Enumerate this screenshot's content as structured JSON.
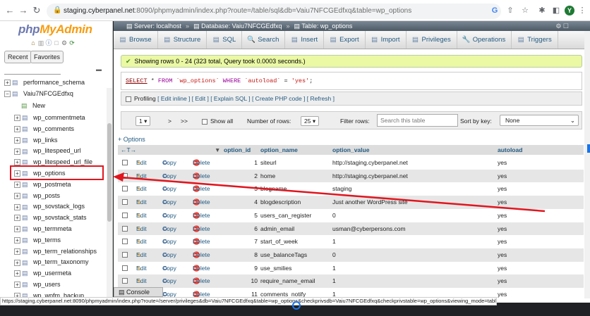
{
  "browser": {
    "url_host": "staging.cyberpanel.net",
    "url_rest": ":8090/phpmyadmin/index.php?route=/table/sql&db=Vaiu7NFCGEdfxq&table=wp_options",
    "avatar_letter": "Y",
    "icons": [
      "back-icon",
      "forward-icon",
      "reload-icon",
      "lock-icon",
      "google-icon",
      "share-icon",
      "star-icon",
      "extension-icon",
      "sidepanel-icon",
      "menu-icon"
    ]
  },
  "sidebar": {
    "logo_a": "php",
    "logo_b": "MyAdmin",
    "tab_recent": "Recent",
    "tab_favorites": "Favorites",
    "db_perf": "performance_schema",
    "db_current": "Vaiu7NFCGEdfxq",
    "new_label": "New",
    "tables": [
      "wp_commentmeta",
      "wp_comments",
      "wp_links",
      "wp_litespeed_url",
      "wp_litespeed_url_file",
      "wp_options",
      "wp_postmeta",
      "wp_posts",
      "wp_sovstack_logs",
      "wp_sovstack_stats",
      "wp_termmeta",
      "wp_terms",
      "wp_term_relationships",
      "wp_term_taxonomy",
      "wp_usermeta",
      "wp_users",
      "wp_wpfm_backup"
    ]
  },
  "breadcrumb": {
    "server": "Server: localhost",
    "database": "Database: Vaiu7NFCGEdfxq",
    "table": "Table: wp_options"
  },
  "menu": [
    "Browse",
    "Structure",
    "SQL",
    "Search",
    "Insert",
    "Export",
    "Import",
    "Privileges",
    "Operations",
    "Triggers"
  ],
  "message": "Showing rows 0 - 24 (323 total, Query took 0.0003 seconds.)",
  "sql": {
    "select": "SELECT",
    "star": " * ",
    "from": "FROM",
    "table": "`wp_options`",
    "where": "WHERE",
    "col": "`autoload`",
    "eq": " = ",
    "val": "'yes'",
    "end": ";"
  },
  "profiling": {
    "label": "Profiling",
    "links": "[ Edit inline ] [ Edit ] [ Explain SQL ] [ Create PHP code ] [ Refresh ]"
  },
  "nav": {
    "page": "1",
    "next": ">",
    "last": ">>",
    "show_all": "Show all",
    "rows_label": "Number of rows:",
    "rows_value": "25",
    "filter_label": "Filter rows:",
    "filter_placeholder": "Search this table",
    "sort_label": "Sort by key:",
    "sort_value": "None"
  },
  "options_link": "+ Options",
  "table": {
    "headers": {
      "id": "option_id",
      "name": "option_name",
      "value": "option_value",
      "autoload": "autoload"
    },
    "actions": {
      "edit": "Edit",
      "copy": "Copy",
      "delete": "Delete"
    },
    "rows": [
      {
        "id": "1",
        "name": "siteurl",
        "value": "http://staging.cyberpanel.net",
        "autoload": "yes"
      },
      {
        "id": "2",
        "name": "home",
        "value": "http://staging.cyberpanel.net",
        "autoload": "yes"
      },
      {
        "id": "3",
        "name": "blogname",
        "value": "staging",
        "autoload": "yes"
      },
      {
        "id": "4",
        "name": "blogdescription",
        "value": "Just another WordPress site",
        "autoload": "yes"
      },
      {
        "id": "5",
        "name": "users_can_register",
        "value": "0",
        "autoload": "yes"
      },
      {
        "id": "6",
        "name": "admin_email",
        "value": "usman@cyberpersons.com",
        "autoload": "yes"
      },
      {
        "id": "7",
        "name": "start_of_week",
        "value": "1",
        "autoload": "yes"
      },
      {
        "id": "8",
        "name": "use_balanceTags",
        "value": "0",
        "autoload": "yes"
      },
      {
        "id": "9",
        "name": "use_smilies",
        "value": "1",
        "autoload": "yes"
      },
      {
        "id": "10",
        "name": "require_name_email",
        "value": "1",
        "autoload": "yes"
      },
      {
        "id": "11",
        "name": "comments_notify",
        "value": "1",
        "autoload": "yes"
      }
    ]
  },
  "console_label": "Console",
  "status_url": "https://staging.cyberpanel.net:8090/phpmyadmin/index.php?route=/server/privileges&db=Vaiu7NFCGEdfxq&table=wp_options&checkprivsdb=Vaiu7NFCGEdfxq&checkprivstable=wp_options&viewing_mode=table",
  "colors": {
    "annotation": "#e0161f",
    "link": "#235a81",
    "pma_blue": "#6c78af",
    "pma_orange": "#f89c0e"
  }
}
